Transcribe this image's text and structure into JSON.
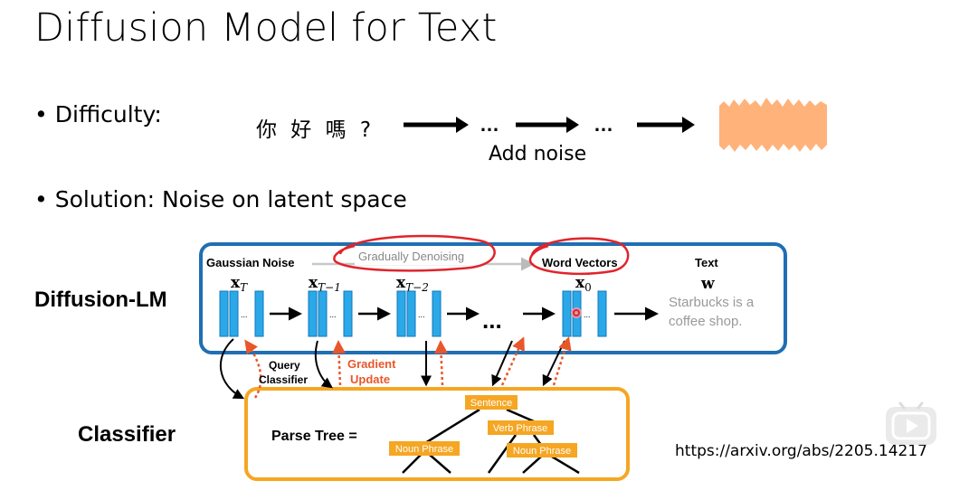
{
  "title": "Diffusion Model for Text",
  "bullets": [
    {
      "label": "Difficulty:"
    },
    {
      "label": "Solution: Noise on latent space"
    }
  ],
  "noise_example": {
    "input_text": "你 好 嗎 ?",
    "ellipsis": "…",
    "caption": "Add noise"
  },
  "diffusion_lm": {
    "label": "Diffusion-LM",
    "gaussian_noise": "Gaussian Noise",
    "gradually_denoising": "Gradually Denoising",
    "word_vectors": "Word Vectors",
    "text_header": "Text",
    "x_T": "x",
    "x_T_sub": "T",
    "x_T1": "x",
    "x_T1_sub": "T−1",
    "x_T2": "x",
    "x_T2_sub": "T−2",
    "x_0": "x",
    "x_0_sub": "0",
    "w": "w",
    "text_line1": "Starbucks is a",
    "text_line2": "coffee shop.",
    "dots": "..."
  },
  "classifier": {
    "label": "Classifier",
    "query_line1": "Query",
    "query_line2": "Classifier",
    "gradient_line1": "Gradient",
    "gradient_line2": "Update",
    "parse_tree": "Parse Tree =",
    "sentence": "Sentence",
    "verb_phrase": "Verb Phrase",
    "noun_phrase_1": "Noun Phrase",
    "noun_phrase_2": "Noun Phrase"
  },
  "url": "https://arxiv.org/abs/2205.14217",
  "colors": {
    "blue_box": "#1f6fb2",
    "orange_box": "#f5a623",
    "vector_blue": "#2ba8e8",
    "gradient_red": "#e8572a",
    "annotation_red": "#e0242b",
    "noise_orange": "#ffb27a",
    "node_fill": "#f5a623"
  },
  "icons": [
    "play-icon"
  ]
}
